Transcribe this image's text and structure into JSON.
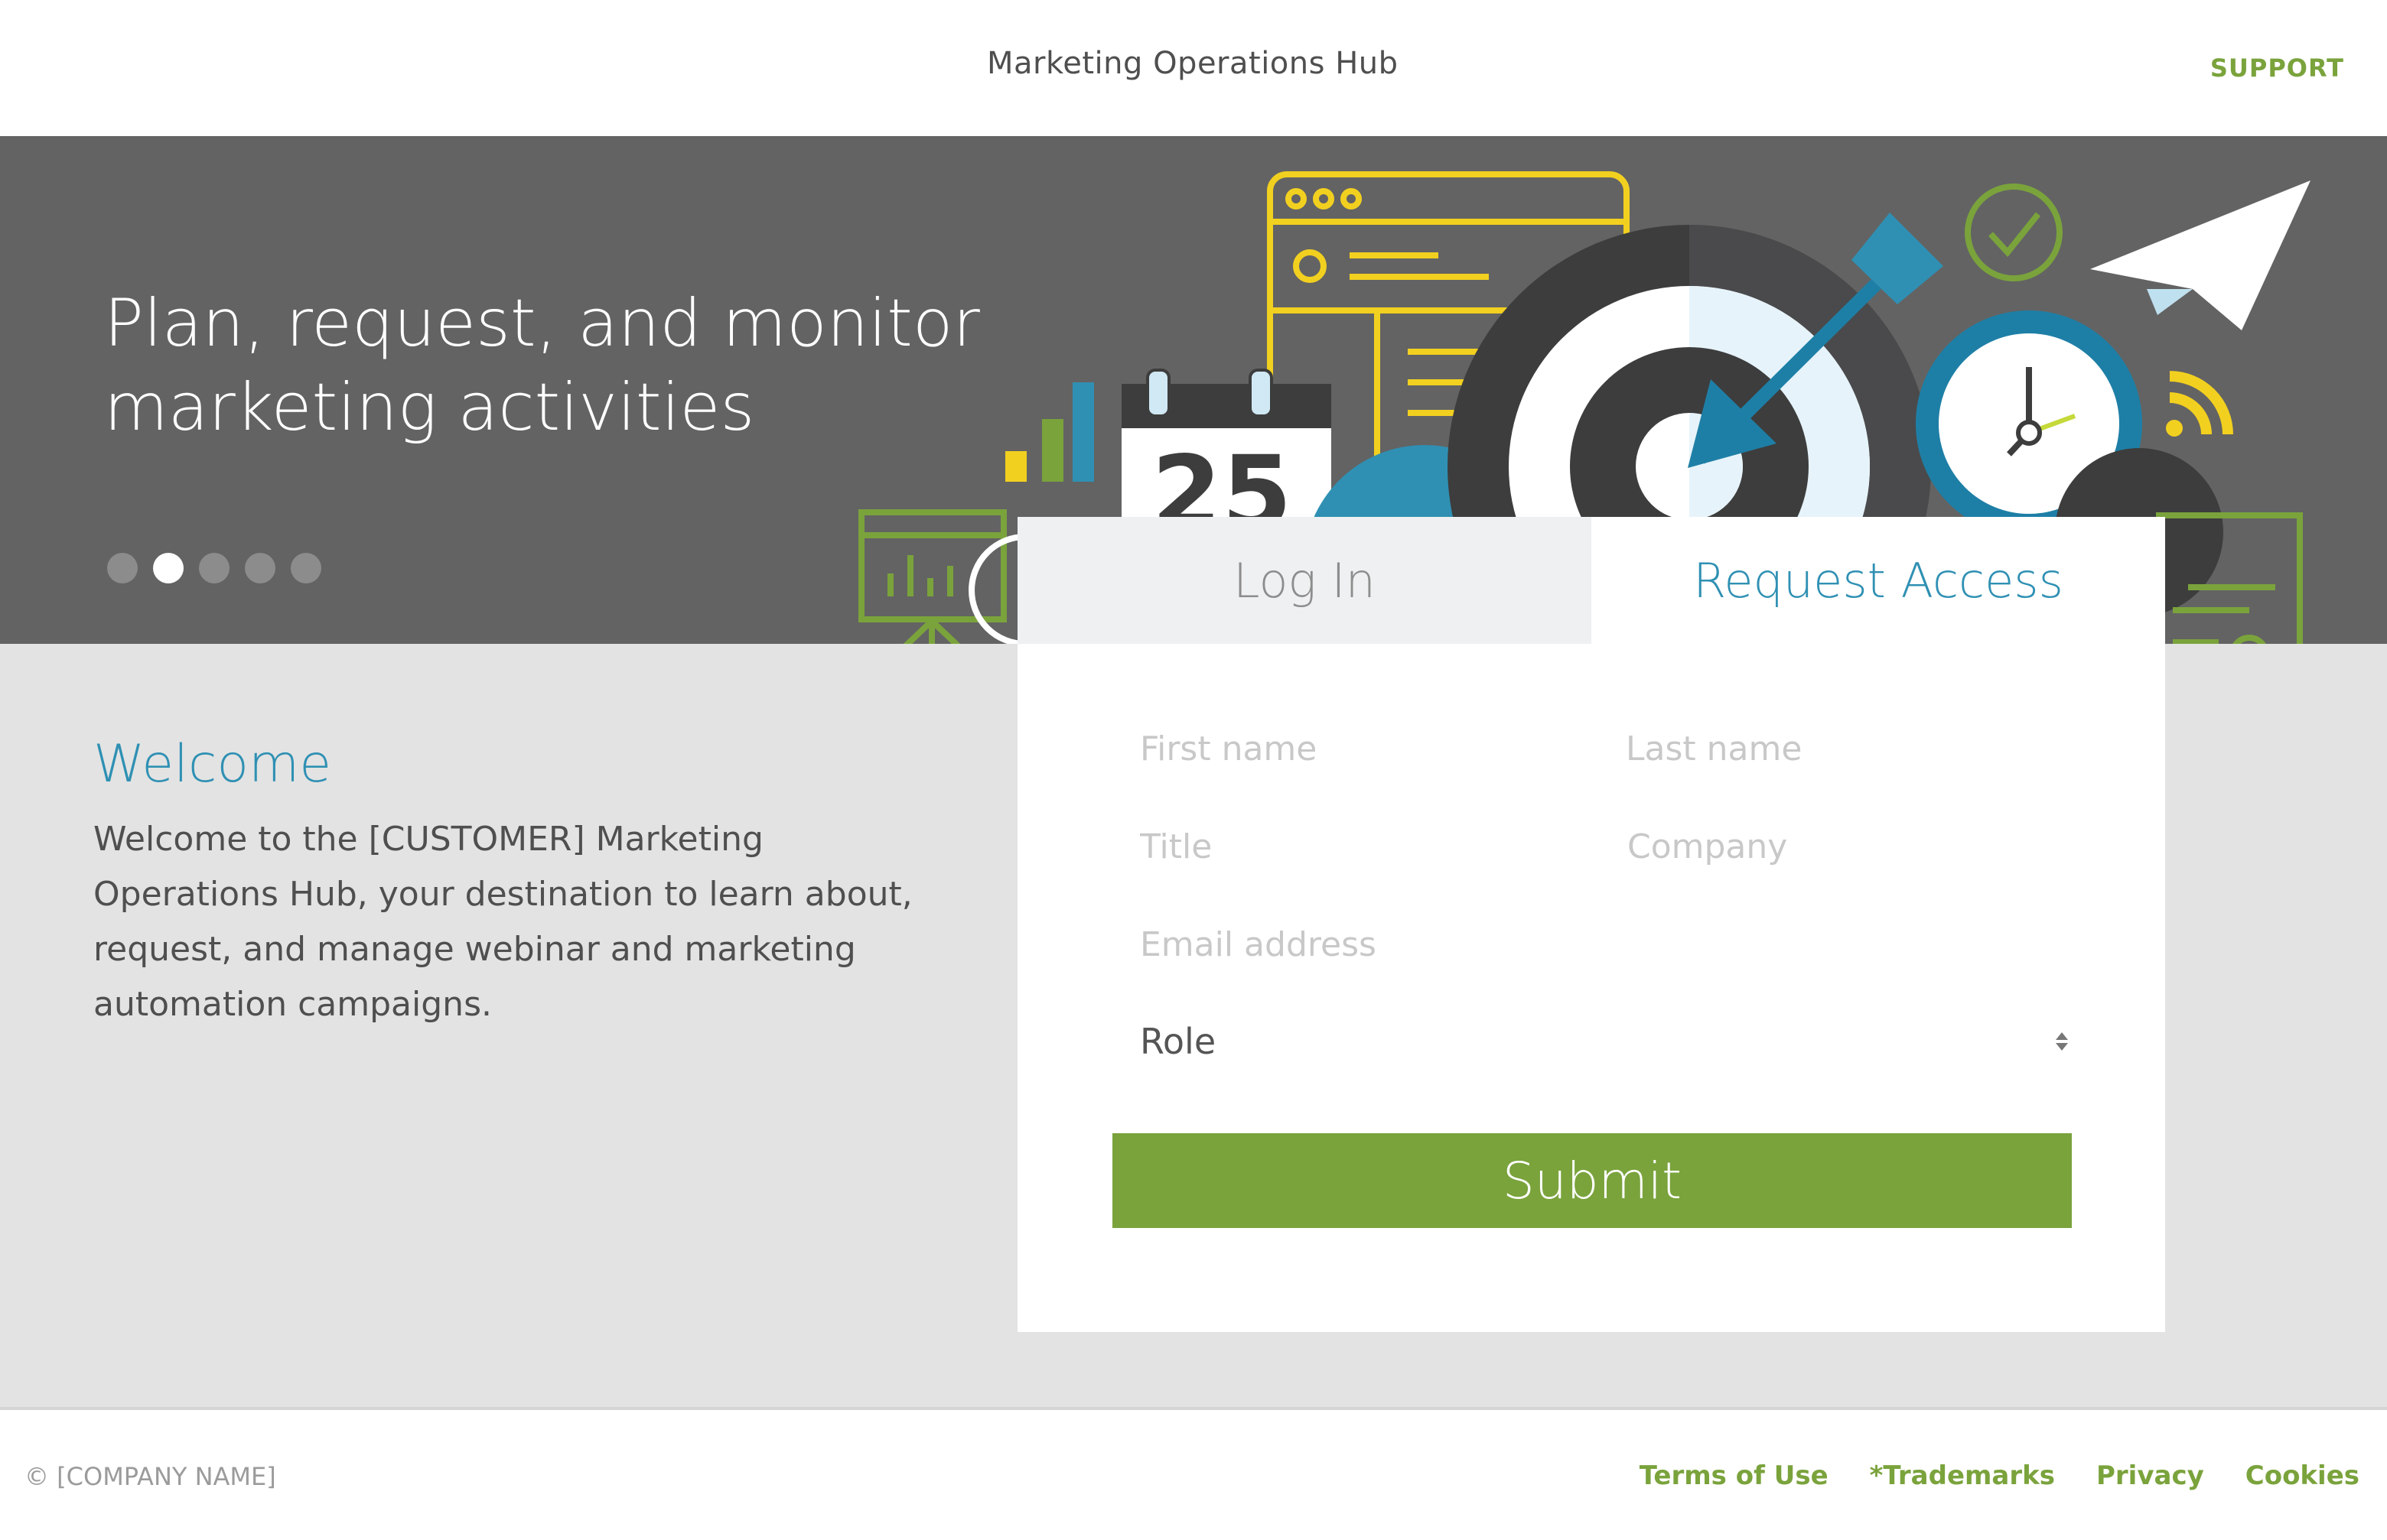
{
  "header": {
    "title": "Marketing Operations Hub",
    "support_label": "SUPPORT"
  },
  "hero": {
    "headline": "Plan, request, and monitor marketing activities",
    "carousel": {
      "slide_count": 5,
      "active_index": 1
    },
    "calendar_day": "25"
  },
  "welcome": {
    "title": "Welcome",
    "text": "Welcome to the [CUSTOMER] Marketing Operations Hub, your destination to learn about, request, and manage webinar and marketing automation campaigns."
  },
  "form": {
    "tabs": [
      {
        "label": "Log In",
        "active": false
      },
      {
        "label": "Request Access",
        "active": true
      }
    ],
    "fields": {
      "first_name_placeholder": "First name",
      "last_name_placeholder": "Last name",
      "title_placeholder": "Title",
      "company_placeholder": "Company",
      "email_placeholder": "Email address"
    },
    "role_select": {
      "selected": "Role"
    },
    "submit_label": "Submit"
  },
  "footer": {
    "copyright": "© [COMPANY NAME]",
    "links": [
      "Terms of Use",
      "*Trademarks",
      "Privacy",
      "Cookies"
    ]
  },
  "colors": {
    "accent_green": "#7aa33c",
    "accent_blue": "#2f90b3",
    "hero_bg": "#636363",
    "content_bg": "#e3e3e3"
  }
}
